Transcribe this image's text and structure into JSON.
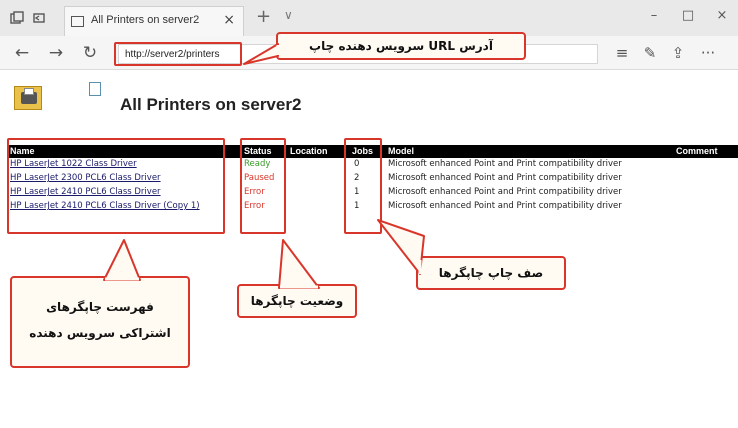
{
  "browser": {
    "tab_title": "All Printers on server2",
    "tab_close": "×",
    "new_tab": "+",
    "tab_menu": "∨",
    "nav": {
      "back": "←",
      "forward": "→",
      "refresh": "↻"
    },
    "address": "http://server2/printers",
    "toolbar": {
      "hub": "≡",
      "notes": "✎",
      "share": "⇪",
      "more": "···"
    },
    "window": {
      "minimize": "–",
      "maximize": "□",
      "close": "×"
    }
  },
  "page": {
    "title": "All Printers on server2",
    "columns": {
      "name": "Name",
      "status": "Status",
      "location": "Location",
      "jobs": "Jobs",
      "model": "Model",
      "comment": "Comment"
    },
    "printers": [
      {
        "name": "HP LaserJet 1022 Class Driver",
        "status": "Ready",
        "jobs": "0",
        "model": "Microsoft enhanced Point and Print compatibility driver"
      },
      {
        "name": "HP LaserJet 2300 PCL6 Class Driver",
        "status": "Paused",
        "jobs": "2",
        "model": "Microsoft enhanced Point and Print compatibility driver"
      },
      {
        "name": "HP LaserJet 2410 PCL6 Class Driver",
        "status": "Error",
        "jobs": "1",
        "model": "Microsoft enhanced Point and Print compatibility driver"
      },
      {
        "name": "HP LaserJet 2410 PCL6 Class Driver (Copy 1)",
        "status": "Error",
        "jobs": "1",
        "model": "Microsoft enhanced Point and Print compatibility driver"
      }
    ]
  },
  "annotations": {
    "url_label": "آدرس URL سرویس دهنده چاپ",
    "shared_printers_line1": "فهرست چاپگرهای",
    "shared_printers_line2": "اشتراکی سرویس دهنده",
    "printer_status": "وضعیت چاپگرها",
    "print_queue": "صف چاپ چاپگرها"
  },
  "colors": {
    "highlight": "#d9362b",
    "status_ready": "#3a9a2a",
    "status_paused": "#d9362b",
    "status_error": "#d9362b",
    "header_bg": "#000000"
  }
}
